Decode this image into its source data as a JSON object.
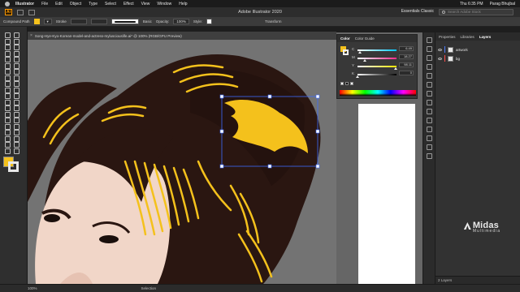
{
  "menubar": {
    "app": "Illustrator",
    "items": [
      "File",
      "Edit",
      "Object",
      "Type",
      "Select",
      "Effect",
      "View",
      "Window",
      "Help"
    ],
    "clock": "Thu 6:35 PM",
    "user": "Parag Bhujbal"
  },
  "appbar": {
    "logo": "Ai",
    "title": "Adobe Illustrator 2020",
    "workspace": "Essentials Classic",
    "search_placeholder": "Search Adobe Stock"
  },
  "control_bar": {
    "selection": "Compound Path",
    "stroke_label": "Stroke",
    "brush": "Basic",
    "opacity_label": "Opacity:",
    "opacity_value": "100%",
    "style_label": "Style:",
    "transform_label": "Transform",
    "fill_color": "#f4c11c"
  },
  "document_tab": {
    "title": "Song-Hye-Kyo-Korean-model-and-actress-mylusciouslife.ai* @ 100% (RGB/GPU Preview)"
  },
  "color_panel": {
    "tabs": [
      "Color",
      "Color Guide"
    ],
    "active_tab": "Color",
    "channels": [
      {
        "name": "C",
        "value": "6.49",
        "level": 0.06,
        "track": "#00c8ff"
      },
      {
        "name": "M",
        "value": "18.27",
        "level": 0.18,
        "track": "#ff2a8a"
      },
      {
        "name": "Y",
        "value": "98.11",
        "level": 0.98,
        "track": "#ffe600"
      },
      {
        "name": "K",
        "value": "0",
        "level": 0.0,
        "track": "#000000"
      }
    ]
  },
  "layers_panel": {
    "tabs": [
      "Properties",
      "Libraries",
      "Layers"
    ],
    "active_tab": "Layers",
    "layers": [
      {
        "name": "artwork"
      },
      {
        "name": "bg"
      }
    ],
    "footer": "2 Layers"
  },
  "status_bar": {
    "zoom": "100%",
    "tool": "Selection"
  },
  "watermark": {
    "name": "Midas",
    "sub": "Multimedia"
  },
  "colors": {
    "hair": "#2a1611",
    "highlight": "#f4c11c",
    "skin": "#f1d6c8",
    "canvas_bg": "#6f6f6f",
    "selection": "#3d6bff"
  }
}
